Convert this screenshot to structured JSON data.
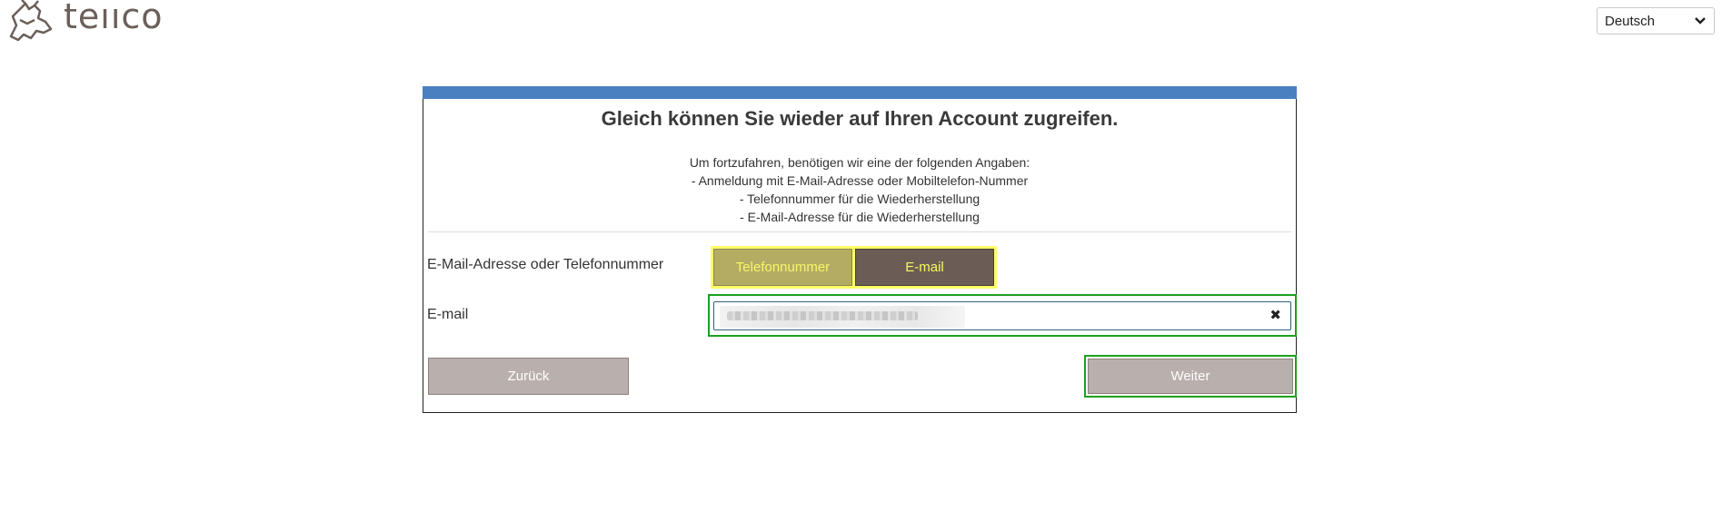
{
  "header": {
    "logo_text": "teııco",
    "language_select": {
      "selected": "Deutsch"
    }
  },
  "card": {
    "title": "Gleich können Sie wieder auf Ihren Account zugreifen.",
    "description": [
      "Um fortzufahren, benötigen wir eine der folgenden Angaben:",
      "- Anmeldung mit E-Mail-Adresse oder Mobiltelefon-Nummer",
      "- Telefonnummer für die Wiederherstellung",
      "- E-Mail-Adresse für die Wiederherstellung"
    ],
    "method_row": {
      "label": "E-Mail-Adresse oder Telefonnummer",
      "options": [
        "Telefonnummer",
        "E-mail"
      ],
      "selected": "E-mail"
    },
    "email_row": {
      "label": "E-mail",
      "clear_symbol": "✖"
    },
    "buttons": {
      "back": "Zurück",
      "next": "Weiter"
    }
  },
  "colors": {
    "accent_bar": "#4a80c0",
    "highlight_yellow": "#ffff66",
    "highlight_green": "#1ea01e",
    "selected_toggle": "#6b5d55",
    "unselected_toggle": "#b5ac63",
    "button_gray": "#b9afac"
  }
}
